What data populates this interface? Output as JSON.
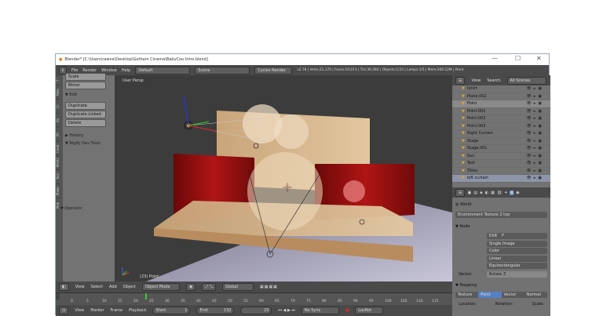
{
  "title": "Blender* [C:\\Users\\rawve\\Desktop\\Gotham Cinema\\BabyCoo Intro.blend]",
  "window_controls": [
    "—",
    "☐",
    "✕"
  ],
  "menu": [
    "File",
    "Render",
    "Window",
    "Help"
  ],
  "layout": "Default",
  "scene": "Scene",
  "engine": "Cycles Render",
  "stats": "v2.78 | Verts:21,170 | Faces:19,013 | Tris:36,560 | Objects:1/23 | Lamps:1/5 | Mem:269.52M | Point",
  "left_tabs": [
    "T",
    "Rela",
    "Cr",
    "An",
    "Ph",
    "Creat",
    "MHX2",
    "Tool",
    "Make",
    "Mak"
  ],
  "toolshelf": {
    "scale": "Scale",
    "mirror": "Mirror",
    "edit": "▼ Edit",
    "duplicate": "Duplicate",
    "duplicate_linked": "Duplicate Linked",
    "delete": "Delete",
    "history": "▶ History",
    "rigify": "▼ Rigify Dev Tools",
    "operator": "▼ Operator"
  },
  "viewport": {
    "label": "User Persp",
    "object_label": "(23) Point"
  },
  "outliner": {
    "view": "View",
    "search": "Search",
    "filter": "All Scenes",
    "items": [
      "tshirt",
      "Plane.002",
      "Point",
      "Point.001",
      "Point.002",
      "Point.003",
      "Right Curtain",
      "Stage",
      "Stage.001",
      "Sun",
      "Text",
      "Titles",
      "left curtain"
    ],
    "selected": "Point"
  },
  "properties": {
    "world": "World",
    "env": "Environment Texture 2 top",
    "node": "▼ Node",
    "image": "EXR",
    "frame": "F",
    "options": [
      "Single Image",
      "Color",
      "Linear",
      "Equirectangular"
    ],
    "vector_label": "Vector:",
    "vector_value": "Rotate Z",
    "mapping": "▼ Mapping",
    "map_tabs": [
      "Texture",
      "Point",
      "Vector",
      "Normal"
    ],
    "active_map_tab": "Point",
    "cols": [
      "Location:",
      "Rotation:",
      "Scale:"
    ]
  },
  "view3d_header": {
    "menu": [
      "View",
      "Select",
      "Add",
      "Object"
    ],
    "mode": "Object Mode",
    "orientation": "Global"
  },
  "timeline": {
    "ticks": [
      "0",
      "5",
      "10",
      "15",
      "20",
      "25",
      "30",
      "35",
      "40",
      "45",
      "50",
      "55",
      "60",
      "65",
      "70",
      "75",
      "80",
      "85",
      "90",
      "95",
      "100",
      "105",
      "110",
      "115"
    ],
    "current_frame": 23
  },
  "timeline_header": {
    "menu": [
      "View",
      "Marker",
      "Frame",
      "Playback"
    ],
    "start_label": "Start:",
    "start": "1",
    "end_label": "End:",
    "end": "132",
    "frame": "23",
    "sync": "No Sync",
    "keying": "LocRot"
  }
}
